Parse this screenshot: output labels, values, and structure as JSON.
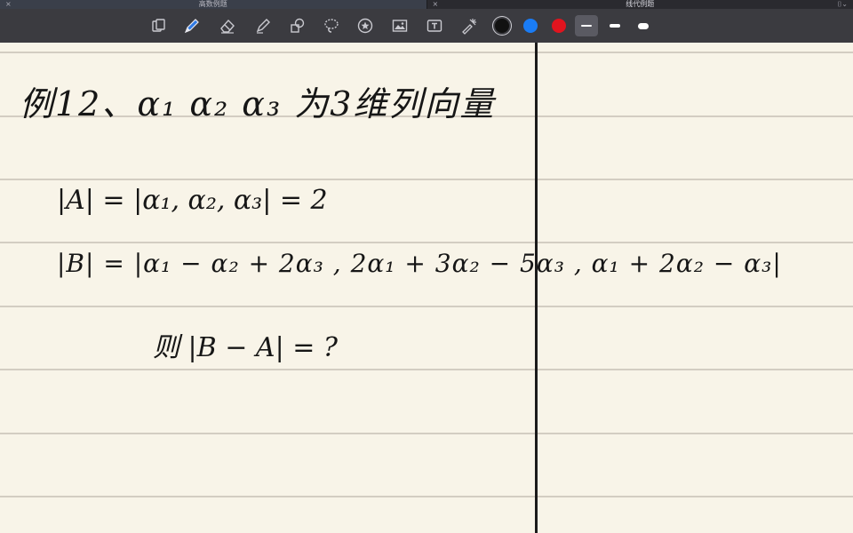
{
  "tabs": [
    {
      "title": "高数例题",
      "close": "×"
    },
    {
      "title": "线代例题",
      "close": "×"
    }
  ],
  "tab_menu": "⌷⌄",
  "toolbar": {
    "tools": [
      "read-only-icon",
      "pen-icon",
      "eraser-icon",
      "highlighter-icon",
      "shapes-icon",
      "lasso-icon",
      "sticker-icon",
      "image-icon",
      "text-icon",
      "laser-pointer-icon"
    ],
    "colors": [
      "#111111",
      "#1a7cf5",
      "#e0141e"
    ],
    "selected_color": "#111111",
    "stroke_widths": [
      "thin",
      "medium",
      "thick"
    ],
    "selected_stroke": "thin"
  },
  "note": {
    "line1": "例12、α₁ α₂ α₃ 为3维列向量",
    "line2": "|A| = |α₁, α₂, α₃| = 2",
    "line3": "|B| = |α₁ − α₂ + 2α₃ , 2α₁ + 3α₂ − 5α₃ , α₁ + 2α₂ − α₃|",
    "line4": "则 |B − A| = ?"
  }
}
